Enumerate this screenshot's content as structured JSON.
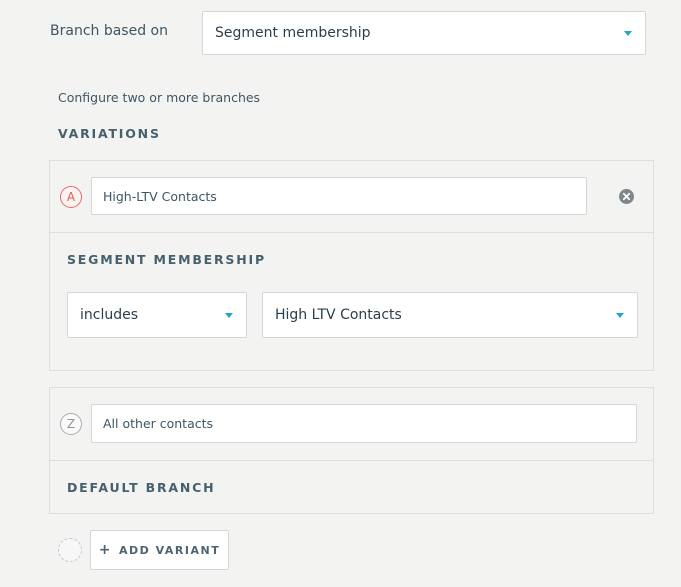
{
  "branch": {
    "label": "Branch based on",
    "selected": "Segment membership"
  },
  "config_text": "Configure two or more branches",
  "variations_heading": "VARIATIONS",
  "variant_a": {
    "badge": "A",
    "name": "High-LTV Contacts",
    "condition_heading": "SEGMENT MEMBERSHIP",
    "operator": "includes",
    "segment": "High LTV Contacts"
  },
  "variant_z": {
    "badge": "Z",
    "name": "All other contacts",
    "heading": "DEFAULT BRANCH"
  },
  "add_variant": {
    "label": "ADD VARIANT",
    "icon": "+"
  },
  "colors": {
    "accent": "#1fa7c9",
    "badge_a": "#e05a52",
    "background": "#f3f3f2"
  }
}
